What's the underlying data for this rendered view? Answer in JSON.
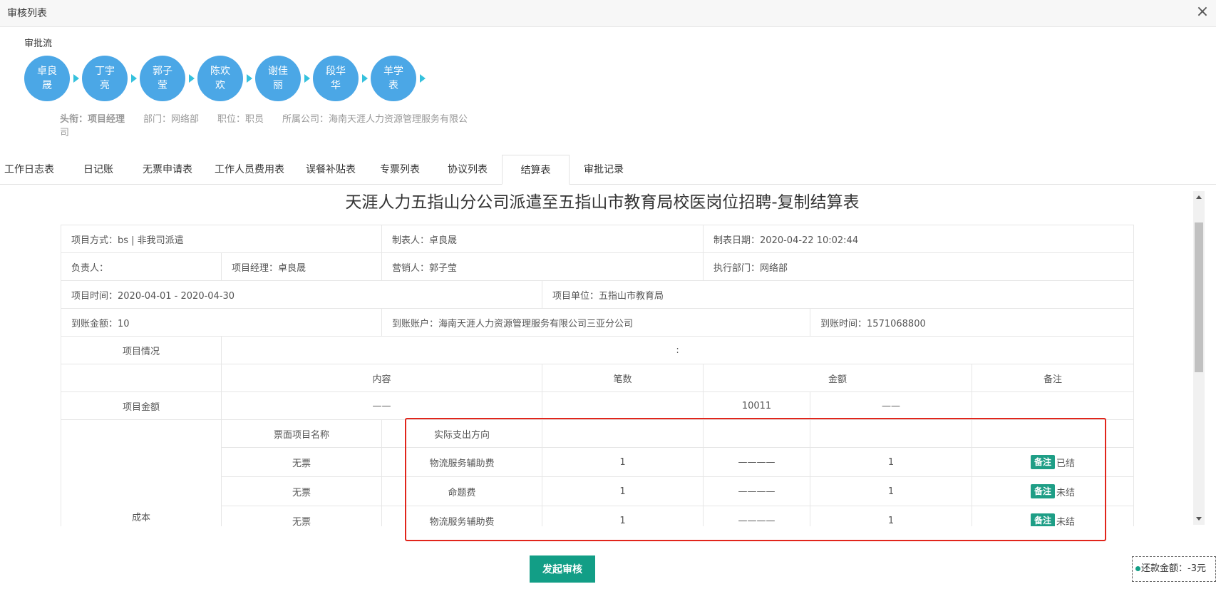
{
  "window": {
    "title": "审核列表",
    "close_label": "×"
  },
  "flow": {
    "label": "审批流",
    "nodes": [
      "卓良晟",
      "丁宇亮",
      "郭子莹",
      "陈欢欢",
      "谢佳丽",
      "段华华",
      "羊学表"
    ]
  },
  "person_info": {
    "title": "头衔：项目经理",
    "department": "部门：网络部",
    "position": "职位：职员",
    "company": "所属公司：海南天涯人力资源管理服务有限公司"
  },
  "tabs": [
    "工作日志表",
    "日记账",
    "无票申请表",
    "工作人员费用表",
    "误餐补贴表",
    "专票列表",
    "协议列表",
    "结算表",
    "审批记录"
  ],
  "active_tab": "结算表",
  "document": {
    "title": "天涯人力五指山分公司派遣至五指山市教育局校医岗位招聘-复制结算表",
    "project_mode": "项目方式：bs | 非我司派遣",
    "creator": "制表人：卓良晟",
    "created_date": "制表日期：2020-04-22 10:02:44",
    "responsible": "负责人：",
    "project_manager": "项目经理：卓良晟",
    "marketer": "营销人：郭子莹",
    "exec_dept": "执行部门：网络部",
    "project_time": "项目时间：2020-04-01 - 2020-04-30",
    "project_unit": "项目单位：五指山市教育局",
    "received_amount": "到账金额：10",
    "received_account": "到账账户：海南天涯人力资源管理服务有限公司三亚分公司",
    "received_time": "到账时间：1571068800",
    "situation_label": "项目情况",
    "situation_value": ":",
    "headers": {
      "content": "内容",
      "count": "笔数",
      "amount": "金额",
      "remark": "备注"
    },
    "project_amount_label": "项目金额",
    "project_amount_content": "——",
    "project_amount_value": "10011",
    "project_amount_extra": "——",
    "cost_label": "成本",
    "cost_headers": {
      "invoice_item": "票面项目名称",
      "actual_direction": "实际支出方向"
    },
    "cost_rows": [
      {
        "invoice": "无票",
        "direction": "物流服务辅助费",
        "count": "1",
        "dash": "————",
        "amount": "1",
        "badge": "备注",
        "status": "已结"
      },
      {
        "invoice": "无票",
        "direction": "命题费",
        "count": "1",
        "dash": "————",
        "amount": "1",
        "badge": "备注",
        "status": "未结"
      },
      {
        "invoice": "无票",
        "direction": "物流服务辅助费",
        "count": "1",
        "dash": "————",
        "amount": "1",
        "badge": "备注",
        "status": "未结"
      }
    ]
  },
  "submit_label": "发起审核",
  "repay_label": "还款金额：-3元",
  "colors": {
    "flow_node": "#4ba7e6",
    "primary_button": "#129e86",
    "highlight_box": "#e1251b"
  }
}
